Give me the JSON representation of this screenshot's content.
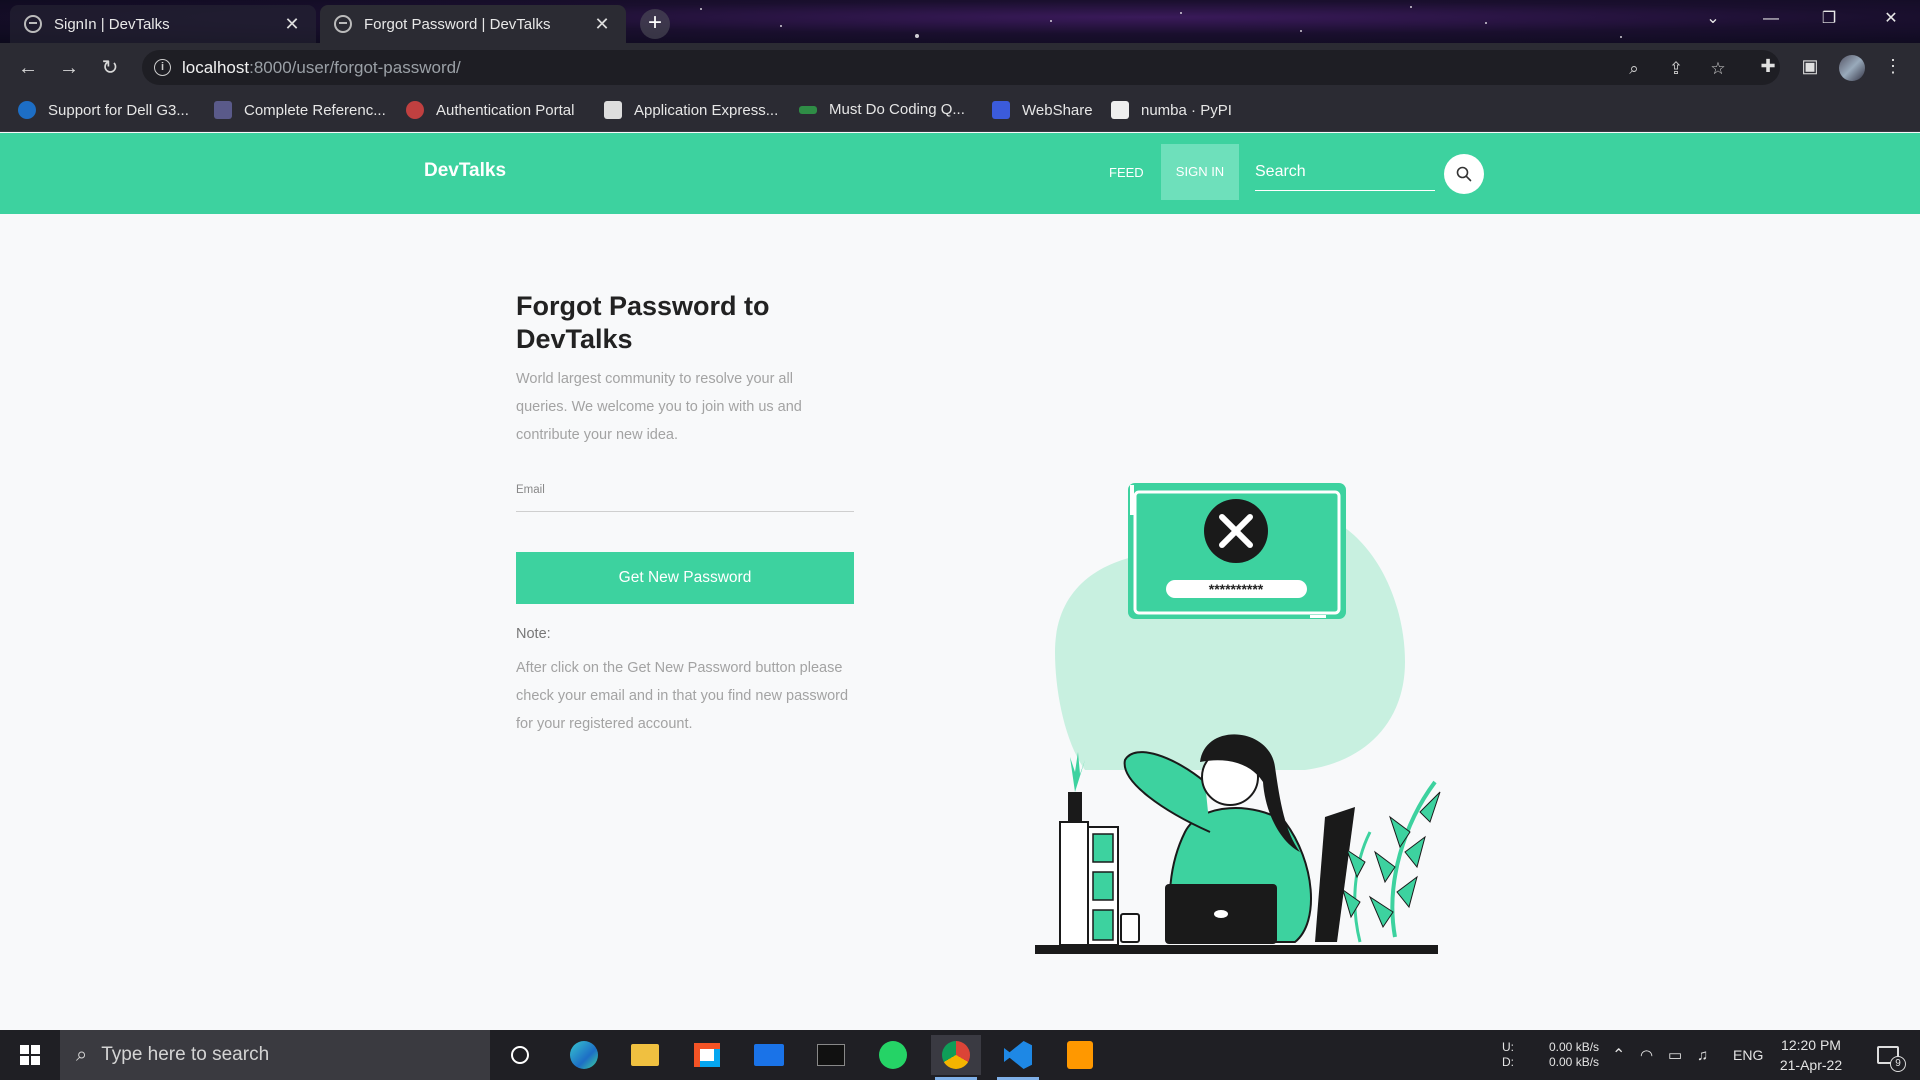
{
  "browser": {
    "tabs": [
      {
        "title": "SignIn | DevTalks",
        "active": false
      },
      {
        "title": "Forgot Password | DevTalks",
        "active": true
      }
    ],
    "url_host": "localhost",
    "url_rest": ":8000/user/forgot-password/",
    "bookmarks": [
      {
        "label": "Support for Dell G3...",
        "color": "#1d6ec5"
      },
      {
        "label": "Complete Referenc...",
        "color": "#5a5a8a"
      },
      {
        "label": "Authentication Portal",
        "color": "#c04040"
      },
      {
        "label": "Application Express...",
        "color": "#dddddd"
      },
      {
        "label": "Must Do Coding Q...",
        "color": "#2f8d46"
      },
      {
        "label": "WebShare",
        "color": "#3b5bdb"
      },
      {
        "label": "numba · PyPI",
        "color": "#eeeeee"
      }
    ]
  },
  "site": {
    "brand": "DevTalks",
    "nav_feed": "FEED",
    "nav_signin": "SIGN IN",
    "search_placeholder": "Search",
    "accent": "#3dd29f"
  },
  "form": {
    "title_line1": "Forgot Password to",
    "title_dev": "Dev",
    "title_talks": "Talks",
    "intro": "World largest community to resolve your all queries. We welcome you to join with us and contribute your new idea.",
    "email_label": "Email",
    "button": "Get New Password",
    "note_label": "Note:",
    "note_text": "After click on the Get New Password button please check your email and in that you find new password for your registered account."
  },
  "illustration": {
    "password_mask": "**********"
  },
  "taskbar": {
    "search_placeholder": "Type here to search",
    "net_up_label": "U:",
    "net_down_label": "D:",
    "net_up": "0.00 kB/s",
    "net_down": "0.00 kB/s",
    "lang": "ENG",
    "time": "12:20 PM",
    "date": "21-Apr-22",
    "notifications": "9"
  }
}
